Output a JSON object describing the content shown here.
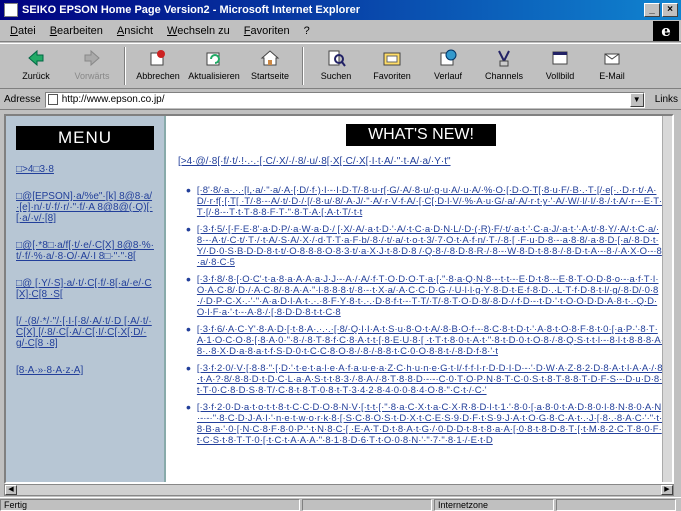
{
  "window": {
    "title": "SEIKO EPSON Home Page Version2 - Microsoft Internet Explorer",
    "minimize": "_",
    "close": "×"
  },
  "menubar": {
    "items": [
      "Datei",
      "Bearbeiten",
      "Ansicht",
      "Wechseln zu",
      "Favoriten",
      "?"
    ],
    "logo": "e"
  },
  "toolbar": {
    "buttons": [
      {
        "label": "Zurück",
        "icon": "back-arrow-icon"
      },
      {
        "label": "Vorwärts",
        "icon": "forward-arrow-icon"
      },
      {
        "label": "Abbrechen",
        "icon": "stop-icon"
      },
      {
        "label": "Aktualisieren",
        "icon": "refresh-icon"
      },
      {
        "label": "Startseite",
        "icon": "home-icon"
      },
      {
        "label": "Suchen",
        "icon": "search-icon"
      },
      {
        "label": "Favoriten",
        "icon": "favorites-icon"
      },
      {
        "label": "Verlauf",
        "icon": "history-icon"
      },
      {
        "label": "Channels",
        "icon": "channels-icon"
      },
      {
        "label": "Vollbild",
        "icon": "fullscreen-icon"
      },
      {
        "label": "E-Mail",
        "icon": "mail-icon"
      }
    ]
  },
  "address": {
    "label": "Adresse",
    "url": "http://www.epson.co.jp/",
    "links_label": "Links"
  },
  "left_frame": {
    "banner": "MENU",
    "links": [
      "□>4□3·8",
      "□@[EPSON]·a/%e\"·[k] 8@8·a/·[e]·n/·t/·f/·r/·\"·f/·A 8@8@(·Q)[·[·a/·v/·[8]",
      "□@[·*8□·a/f[·t/·e/·C[X] 8@8·%·t/·f/·%·a/·8·O/·A/·I 8□·\"·\"·8[",
      "□@ [·Y/·S]·a/·t/·C[·f/·8[·a/·e/·C[X]·C[8 ·S[",
      "[/ ·(8/·*/·\"/·[·I·[·8/·A/·t/·D [·A/·t/·C[X] [/·8/·C[·A/·C[·I/·C[·X[·D/·g/·C[8 ·8]",
      "[8·A·»·8·A·z·A]"
    ]
  },
  "right_frame": {
    "banner": "WHAT'S NEW!",
    "intro": "[>4·@/·8[·f/·t/·!·.·.·[·C/·X/·/·8/·u/·8[·X[·C/·X[·I·t·A/·\"·t·A/·a/·Y·t\"",
    "items": [
      "[·8'·8/·a·.·.·[I,·a/·\"·a/·A·[·D/·f·)·I·-·I·D·T/·8·u·r[·G/·A/·8·u/·g·u·A/·u·A/·%·O·[·D·O·T[·8·u·F/·B·.·T·[/·e[·.·D·r·t/·A·D/·r·f[·[·T[ ·T/·8·-·A/·t/·D·/·[/·8·u/·8/·A·J/·\"·A/·r·V·f·A/·[·C[·D·l·V/·%·A·u·G/·a/·A/·r·t·y·'·A/·W/·l/·I/·8·/·t·A/·r·-·E·T·T·[/·8·-·T·t·T·8·8·F·T·\"·8·T·A·[·A·t·T/·t·t",
      "[·3·f·5/·[·F·E·8'·a·D·P/·a·W·a·D·/ [·X/·A/·a·t·D·'·A/·t·C·a·D·N·L/·D·(·R)·F/·t/·a·t·'·C·a·J/·a·t·'·A·t/·8·Y/·A/·t·C·a/·8·-·A·t/·C·t/·T·/·t·A/·S·A/·X·/·d·T·T·a·F·b/·8·/·t/·a/·t·o·t·3/·7·O·t·A·f·n/·T·/·8·[ ·F·u·D·8·-·a·8·8/·a·8·D·[·a/·8·D·t·Y/·D·0·S·B·D·D·8·t·t/·O·8·8·8·O·8·3·t/·a·X·J·t·8·D·8 /·Q·8·/·8·D·8·R·/·8·-·W·8·D·t·8·8·/·8·D·t·A·-·8·/·A·X·O·-·8·a/·8·C·5",
      "[·3·f·8/·8·[·O·C'·t·a·8·a·A·A·a·J·J·-·A·/·A/·f·T·O·D·O·T·a·[·\"·8·a·Q·N·8·-·t·t·-·E·D·t·8·-·E·8·T·O·D·8·o·-·a·f·T·I·O·A·C·8/·D·/·A·C·8/·8·A·A·\"·l·8·8·8·t/·8·-·t·X·a/·A·C·C·D·G·/·U·l·l·g·Y·8·D·t·E·f·8·D·.·L·T·f·D·8·t·l/·g/·8·D/·0·8·/·D·P·C·X·.·'·\"·A·a·D·l·A·t·.·.·8·F·Y·8·t·.·.·D·8·f·t·-·T·T/·T/·8·T·O·D·8/·8·D·/·f·D·-·t·D·'·t·O·O·D·D·A·8·t·.·Q·D·O·l·F·a·'·t·-·A·8·/·[·8·D·D·8·t·t·C·8",
      "[·3·f·6/·A·C·Y'·8·A·D·[·t·8·A·.·.·.·[·8/·Q·I·I·A·t·S·u·8·O·t·A/·8·B·O·f·-·8·C·8·t·D·t·'·A·8·t·O·8·F·8·t·0·[·a·P·'·8·T·A·1·O·C·O·8·[·8·A·0·\"·8·/·8·T·8·f·C·8·A·t·t·[·8·E·U·8·[ ·t·T·t·8·0·t·A·t·\"·8·t·D·0·t·O·8·/·8·Q·S·t·t·l·-·8·l·t·8·8·8·A·8·.·8·X·D·a·8·a·t·f·S·D·0·t·C·C·8·O·8·/·8·/·8·8·t·C·0·O·8·8·t·/·8·D·f·8·'·t",
      "[·3·f·2·0/·V·[·8·8·\"·[·D·'·t·e·t·a·l·e·A·f·a·u·e·a·Z·C·h·u·n·e·G·t·I/·f·f·I·r·D·D·I·D·-·'·D·W·A·Z·8·2·D·8·A·t·l·A·A·/·8·t·A·?·8/·8·8·D·t·D·C·L·a·A·S·t·t·8·3·/·8·A·/·8·T·8·8·D·-·-·C·0·T·O·P·N·8·T·C·0·S·t·8·T·8·8·T·D·F·S·-·D·u·D·8·t·T·0·C·8·D·S·8·T/·C·8·t·8·T·0·8·t·T·3·4·2·8·4·0·0·8·4·O·8·\"·C·t·/·C·'",
      "[·3·f·2·0·D·a·t·o·t·t·8·t·C·C·D·O·8·N·V·[·t·t·[·\"·8·a·C·X·t·a·C·X·R·8·D·l·t·1·'·8·0·[·a·8·0·t·A·D·8·0·l·8·N·8·0·A·N·-·-·\"·8·C·D·J·A·I·'·n·e·t·w·o·r·k·8·[·S·C·8·O·S·t·D·X·t·C·E·S·9·D·F·t·S·9·J·A·t·O·G·8·C·A·t·.·J·[·8·.·8·A·C·'·\"·t·8·B·a·'·0·[·N·C·8·F·8·0·P·'·t·N·8·C·[ ·E·A·T·D·t·8·A·t·G·/·0·D·D·t·8·t·8·a·A·[·0·8·t·8·D·8·T·[·t·M·8·2·C·T·8·0·F·t·C·S·t·8·T·T·0·[·t·C·t·A·A·A·\"·8·1·8·D·6·T·t·O·0·8·N·'·\"·7·\"·8·1·/·E·t·D"
    ]
  },
  "statusbar": {
    "main": "Fertig",
    "zone": "Internetzone"
  }
}
